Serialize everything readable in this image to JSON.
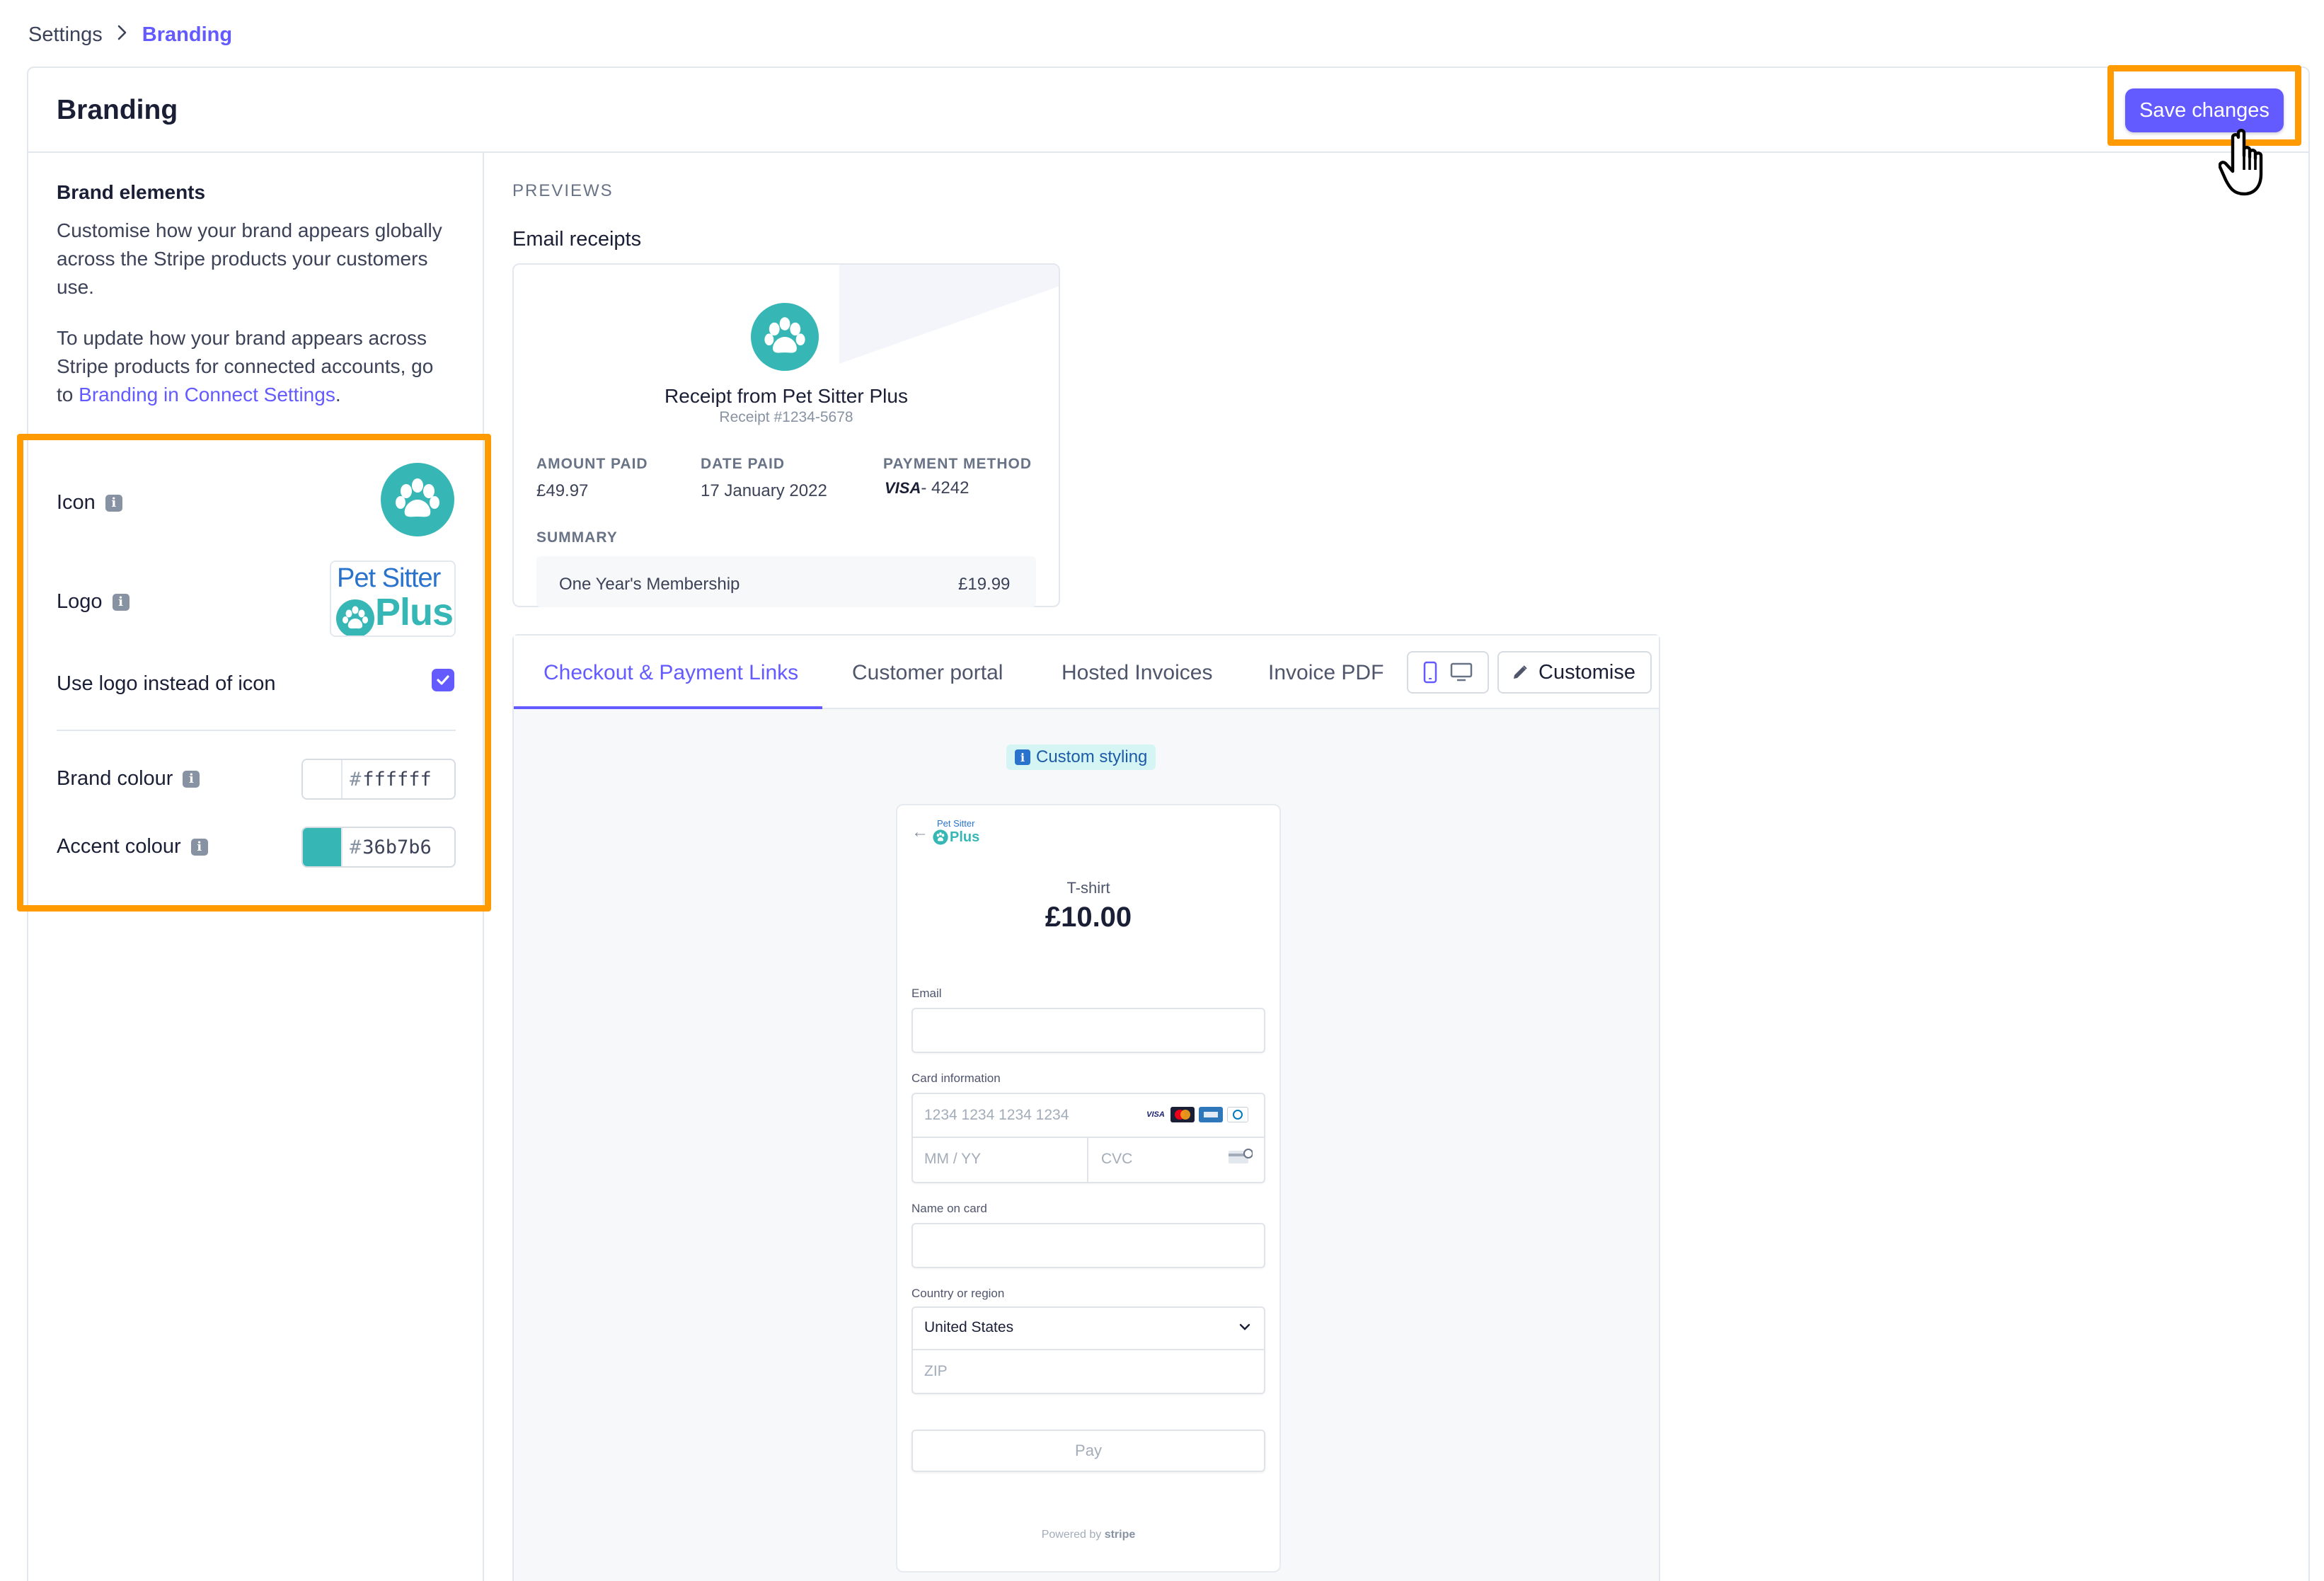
{
  "breadcrumb": {
    "parent": "Settings",
    "current": "Branding"
  },
  "header": {
    "title": "Branding",
    "save_label": "Save changes"
  },
  "brand_elements": {
    "title": "Brand elements",
    "desc1": "Customise how your brand appears globally across the Stripe products your customers use.",
    "desc2_prefix": "To update how your brand appears across Stripe products for connected accounts, go to ",
    "desc2_link": "Branding in Connect Settings",
    "desc2_suffix": ".",
    "icon_label": "Icon",
    "logo_label": "Logo",
    "logo_text_line1": "Pet Sitter",
    "logo_text_line2": "Plus",
    "use_logo_label": "Use logo instead of icon",
    "use_logo_checked": true,
    "brand_colour_label": "Brand colour",
    "brand_colour_value": "ffffff",
    "brand_colour_hex": "#ffffff",
    "accent_colour_label": "Accent colour",
    "accent_colour_value": "36b7b6",
    "accent_colour_hex": "#36b7b6",
    "hash": "#",
    "info_glyph": "i"
  },
  "previews": {
    "section_label": "PREVIEWS",
    "email_label": "Email receipts",
    "receipt": {
      "title": "Receipt from Pet Sitter Plus",
      "number": "Receipt #1234-5678",
      "amount_paid_label": "AMOUNT PAID",
      "amount_paid": "£49.97",
      "date_paid_label": "DATE PAID",
      "date_paid": "17 January 2022",
      "payment_method_label": "PAYMENT METHOD",
      "card_brand": "VISA",
      "card_last4": "- 4242",
      "summary_label": "SUMMARY",
      "line_item": "One Year's Membership",
      "line_amount": "£19.99"
    }
  },
  "tabs": {
    "items": [
      "Checkout & Payment Links",
      "Customer portal",
      "Hosted Invoices",
      "Invoice PDF"
    ],
    "active_index": 0,
    "customise_label": "Customise"
  },
  "checkout_preview": {
    "badge": "Custom styling",
    "back_arrow": "←",
    "logo_line1": "Pet Sitter",
    "logo_line2": "Plus",
    "item_name": "T-shirt",
    "price": "£10.00",
    "email_label": "Email",
    "card_label": "Card information",
    "card_number_placeholder": "1234 1234 1234 1234",
    "expiry_placeholder": "MM / YY",
    "cvc_placeholder": "CVC",
    "card_brands": [
      "VISA",
      "MC",
      "AMEX",
      "DC"
    ],
    "name_label": "Name on card",
    "country_label": "Country or region",
    "country_value": "United States",
    "zip_placeholder": "ZIP",
    "pay_label": "Pay",
    "powered_by": "Powered by",
    "powered_brand": "stripe"
  },
  "colors": {
    "accent": "#36b7b6",
    "primary": "#635bff",
    "highlight": "#ff9a00"
  }
}
